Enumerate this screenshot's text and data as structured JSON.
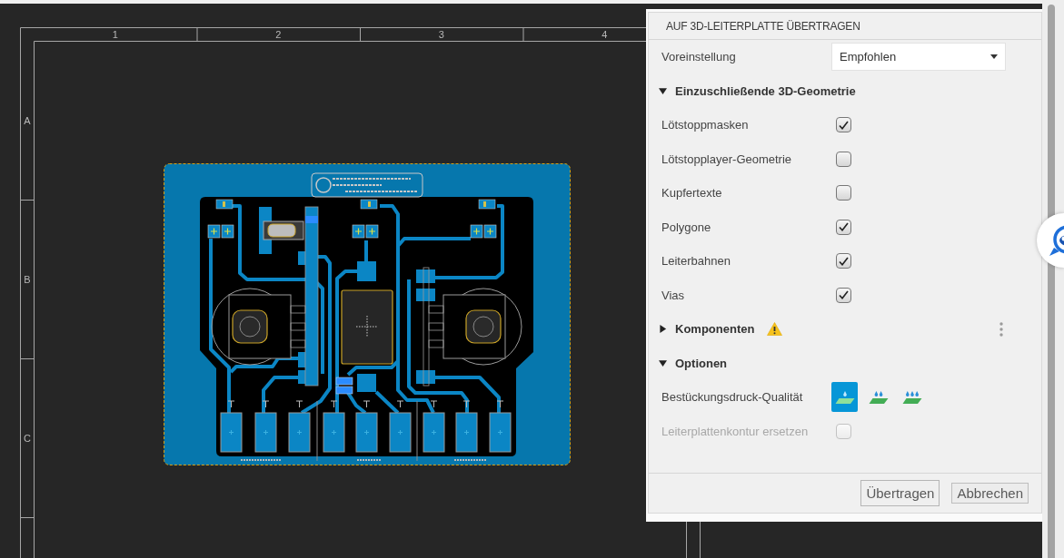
{
  "sheet": {
    "columns": [
      "1",
      "2",
      "3",
      "4"
    ],
    "rows": [
      "A",
      "B",
      "C"
    ]
  },
  "dialog": {
    "title": "AUF 3D-LEITERPLATTE ÜBERTRAGEN",
    "preset": {
      "label": "Voreinstellung",
      "value": "Empfohlen"
    },
    "sections": [
      {
        "title": "Einzuschließende 3D-Geometrie",
        "expanded": true,
        "items": [
          {
            "kind": "checkbox",
            "label": "Lötstoppmasken",
            "checked": true,
            "disabled": false
          },
          {
            "kind": "checkbox",
            "label": "Lötstopplayer-Geometrie",
            "checked": false,
            "disabled": false
          },
          {
            "kind": "checkbox",
            "label": "Kupfertexte",
            "checked": false,
            "disabled": false
          },
          {
            "kind": "checkbox",
            "label": "Polygone",
            "checked": true,
            "disabled": false
          },
          {
            "kind": "checkbox",
            "label": "Leiterbahnen",
            "checked": true,
            "disabled": false
          },
          {
            "kind": "checkbox",
            "label": "Vias",
            "checked": true,
            "disabled": false
          }
        ]
      },
      {
        "title": "Komponenten",
        "expanded": false,
        "warning": true,
        "menu": true
      },
      {
        "title": "Optionen",
        "expanded": true,
        "items": [
          {
            "kind": "quality",
            "label": "Bestückungsdruck-Qualität",
            "options": [
              {
                "selected": true
              },
              {
                "selected": false
              },
              {
                "selected": false
              }
            ]
          },
          {
            "kind": "checkbox",
            "label": "Leiterplattenkontur ersetzen",
            "checked": false,
            "disabled": true
          }
        ]
      }
    ],
    "buttons": [
      {
        "label": "Übertragen",
        "kind": "default"
      },
      {
        "label": "Abbrechen",
        "kind": "normal"
      }
    ]
  }
}
